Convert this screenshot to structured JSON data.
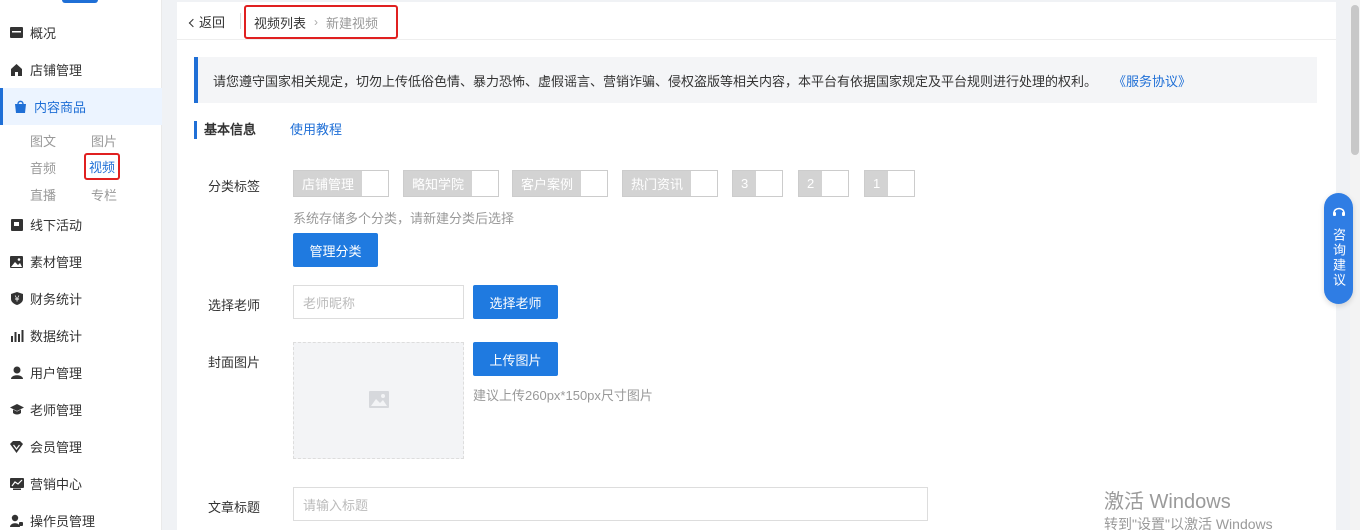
{
  "sidebar": {
    "items": [
      {
        "label": "概况",
        "icon": "dashboard-icon"
      },
      {
        "label": "店铺管理",
        "icon": "store-icon"
      },
      {
        "label": "内容商品",
        "icon": "bag-icon"
      },
      {
        "label": "线下活动",
        "icon": "flag-icon"
      },
      {
        "label": "素材管理",
        "icon": "image-icon"
      },
      {
        "label": "财务统计",
        "icon": "money-shield-icon"
      },
      {
        "label": "数据统计",
        "icon": "bar-chart-icon"
      },
      {
        "label": "用户管理",
        "icon": "user-icon"
      },
      {
        "label": "老师管理",
        "icon": "teacher-icon"
      },
      {
        "label": "会员管理",
        "icon": "vip-icon"
      },
      {
        "label": "营销中心",
        "icon": "trend-icon"
      },
      {
        "label": "操作员管理",
        "icon": "operator-icon"
      }
    ],
    "subitems": [
      "图文",
      "图片",
      "音频",
      "视频",
      "直播",
      "专栏"
    ]
  },
  "header": {
    "back_label": "返回",
    "breadcrumb": [
      "视频列表",
      "新建视频"
    ]
  },
  "notice": {
    "text": "请您遵守国家相关规定，切勿上传低俗色情、暴力恐怖、虚假谣言、营销诈骗、侵权盗版等相关内容，本平台有依据国家规定及平台规则进行处理的权利。",
    "link": "《服务协议》"
  },
  "section": {
    "title": "基本信息",
    "tutorial": "使用教程"
  },
  "form": {
    "category": {
      "label": "分类标签",
      "tags": [
        "店铺管理",
        "略知学院",
        "客户案例",
        "热门资讯",
        "3",
        "2",
        "1"
      ],
      "hint": "系统存储多个分类，请新建分类后选择",
      "manage_button": "管理分类"
    },
    "teacher": {
      "label": "选择老师",
      "placeholder": "老师昵称",
      "button": "选择老师"
    },
    "cover": {
      "label": "封面图片",
      "button": "上传图片",
      "hint": "建议上传260px*150px尺寸图片"
    },
    "title": {
      "label": "文章标题",
      "placeholder": "请输入标题"
    }
  },
  "consult": {
    "label": "咨询建议"
  },
  "watermark": {
    "line1": "激活 Windows",
    "line2": "转到\"设置\"以激活 Windows"
  },
  "colors": {
    "accent": "#1f7ae0",
    "highlight": "#e02020"
  }
}
